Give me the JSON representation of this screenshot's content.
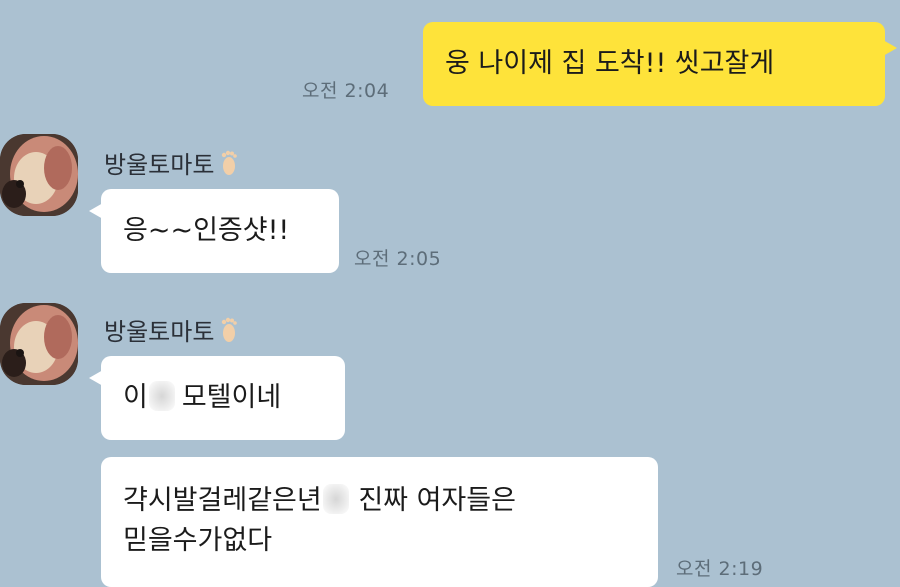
{
  "messages": {
    "m1": {
      "text": "웅 나이제 집 도착!! 씻고잘게",
      "time": "오전 2:04"
    },
    "m2": {
      "sender": "방울토마토",
      "text": "응~~인증샷!!",
      "time": "오전 2:05"
    },
    "m3": {
      "sender": "방울토마토",
      "text_a": "이",
      "text_b": "모텔이네"
    },
    "m4": {
      "text_a": "갹시발걸레같은년",
      "text_b": "진짜 여자들은",
      "text_c": "믿을수가없다",
      "time": "오전 2:19"
    }
  },
  "colors": {
    "background": "#abc1d1",
    "my_bubble": "#fee33a",
    "their_bubble": "#ffffff"
  },
  "icons": {
    "sender_badge": "foot-icon",
    "avatar": "profile-photo"
  }
}
